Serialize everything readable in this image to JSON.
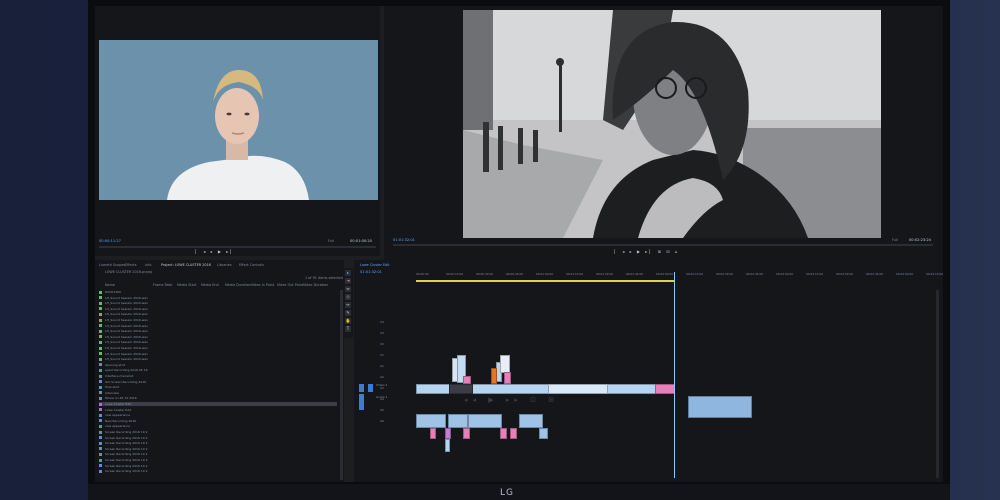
{
  "brand": "LG",
  "source_monitor": {
    "timecode_left": "00:00:11:27",
    "timecode_right": "00:01:00:20",
    "fit": "Full"
  },
  "program_monitor": {
    "timecode_left": "01:01:32:01",
    "timecode_right": "00:02:23:24",
    "fit": "Full"
  },
  "project_panel": {
    "tabs": [
      "Lumetri Scopes",
      "Effects",
      "Info",
      "Project: LOWE CLUSTER 2016",
      "Libraries",
      "Effect Controls"
    ],
    "path": "LOWE CLUSTER 2016.prproj",
    "items_count": "1 of 91 items selected",
    "columns": [
      "Name",
      "Frame Rate",
      "Media Start",
      "Media End",
      "Media Duration",
      "Video In Point",
      "Video Out Point",
      "Video Duration"
    ],
    "rows": [
      {
        "name": "DSC01300",
        "color": "#56c16c"
      },
      {
        "name": "LH_Sound Session 2016.wav",
        "color": "#56c16c"
      },
      {
        "name": "LH_Sound Session 2016.wav",
        "color": "#56c16c"
      },
      {
        "name": "LH_Sound Session 2016.wav",
        "color": "#56c16c"
      },
      {
        "name": "LH_Sound Session 2016.wav",
        "color": "#56c16c"
      },
      {
        "name": "LH_Sound Session 2016.wav",
        "color": "#56c16c"
      },
      {
        "name": "LH_Sound Session 2016.wav",
        "color": "#56c16c"
      },
      {
        "name": "LH_Sound Session 2016.wav",
        "color": "#56c16c"
      },
      {
        "name": "LH_Sound Session 2016.wav",
        "color": "#56c16c"
      },
      {
        "name": "LH_Sound Session 2016.wav",
        "color": "#56c16c"
      },
      {
        "name": "LH_Sound Session 2016.wav",
        "color": "#56c16c"
      },
      {
        "name": "LH_Sound Session 2016.wav",
        "color": "#56c16c"
      },
      {
        "name": "LH_Sound Session 2016.wav",
        "color": "#56c16c"
      },
      {
        "name": "Opening shot",
        "color": "#5a8ee0"
      },
      {
        "name": "spent Recording 2016 05 18",
        "color": "#5a8ee0"
      },
      {
        "name": "Interface mainshot",
        "color": "#5a8ee0"
      },
      {
        "name": "Girl Screen Recording 2016",
        "color": "#5a8ee0"
      },
      {
        "name": "final shot",
        "color": "#5a8ee0"
      },
      {
        "name": "Interview",
        "color": "#5a8ee0"
      },
      {
        "name": "Movie on 26 10 2016",
        "color": "#5a8ee0"
      },
      {
        "name": "Lowe Cluster Edit",
        "color": "#b06bd6"
      },
      {
        "name": "Lowe Cluster Edit",
        "color": "#b06bd6"
      },
      {
        "name": "new appearance",
        "color": "#5a8ee0"
      },
      {
        "name": "New Recording 2016",
        "color": "#5a8ee0"
      },
      {
        "name": "new appearance",
        "color": "#5a8ee0"
      },
      {
        "name": "Screen Recording 2016 10 2",
        "color": "#5a8ee0"
      },
      {
        "name": "Screen Recording 2016 10 2",
        "color": "#5a8ee0"
      },
      {
        "name": "Screen Recording 2016 10 2",
        "color": "#5a8ee0"
      },
      {
        "name": "Screen Recording 2016 10 2",
        "color": "#5a8ee0"
      },
      {
        "name": "Screen Recording 2016 10 2",
        "color": "#5a8ee0"
      },
      {
        "name": "Screen Recording 2016 10 2",
        "color": "#5a8ee0"
      },
      {
        "name": "Screen Recording 2016 10 2",
        "color": "#5a8ee0"
      },
      {
        "name": "Screen Recording 2016 10 2",
        "color": "#5a8ee0"
      }
    ]
  },
  "timeline": {
    "tab": "Lowe Cluster Edit",
    "timecode": "01:01:32:01",
    "ruler": [
      "00:00:00",
      "00:00:15:00",
      "00:00:30:00",
      "00:00:45:00",
      "00:01:00:00",
      "00:01:15:00",
      "00:01:30:00",
      "00:01:45:00",
      "00:02:00:00",
      "00:02:15:00",
      "00:02:30:00",
      "00:02:45:00",
      "00:03:00:00",
      "00:03:15:00",
      "00:03:30:00",
      "00:03:45:00",
      "00:04:00:00",
      "00:04:15:00"
    ],
    "tracks": [
      "V4",
      "V3",
      "V2",
      "V1",
      "A1",
      "A2",
      "A3",
      "A4",
      "A5",
      "A6"
    ],
    "track_labels": [
      "Video 1",
      "Audio 1"
    ]
  },
  "colors": {
    "accent": "#5ea7ff",
    "clip_video": "#b5d4ee",
    "clip_pink": "#e77fb9",
    "clip_orange": "#e0772a",
    "playhead": "#8fc7ff"
  }
}
